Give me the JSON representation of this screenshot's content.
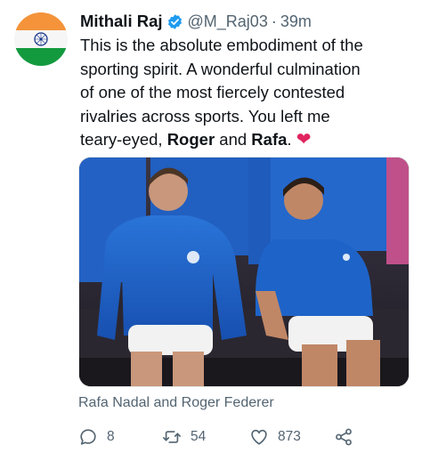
{
  "tweet": {
    "author_name": "Mithali Raj",
    "handle": "@M_Raj03",
    "separator": "·",
    "time": "39m",
    "text_lines": [
      "This is the absolute embodiment of the",
      "sporting spirit. A wonderful culmination",
      "of one of the most fiercely contested",
      "rivalries across sports. You left me",
      "teary-eyed,"
    ],
    "bold_name_1": "Roger",
    "and_word": "and",
    "bold_name_2": "Rafa",
    "period": ".",
    "heart_emoji": "❤",
    "media_caption": "Rafa Nadal and Roger Federer"
  },
  "actions": {
    "replies": "8",
    "retweets": "54",
    "likes": "873"
  },
  "icons": {
    "avatar": "india-flag-icon",
    "verified": "verified-badge-icon",
    "reply": "reply-icon",
    "retweet": "retweet-icon",
    "like": "like-heart-icon",
    "share": "share-icon"
  },
  "colors": {
    "verified": "#1d9bf0",
    "heart": "#e0245e",
    "secondary_text": "#536471",
    "jacket_blue": "#1e63c8"
  }
}
